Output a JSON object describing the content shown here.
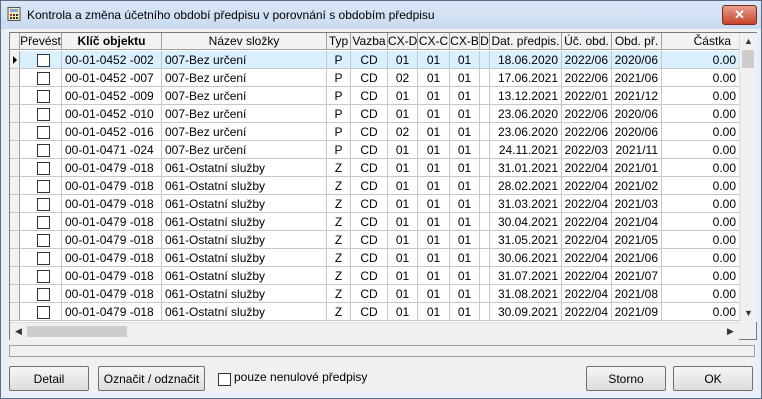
{
  "window": {
    "title": "Kontrola a změna účetního období předpisu v porovnání s obdobím předpisu",
    "close_glyph": "✕"
  },
  "table": {
    "columns": [
      "Převést",
      "Klíč objektu",
      "Název složky",
      "Typ",
      "Vazba",
      "CX-D",
      "CX-C",
      "CX-B",
      "D",
      "Dat. předpis.",
      "Úč. obd.",
      "Obd. př.",
      "Částka"
    ],
    "rows": [
      {
        "klic": "00-01-0452 -002",
        "nazev": "007-Bez určení",
        "typ": "P",
        "vazba": "CD",
        "cxd": "01",
        "cxc": "01",
        "cxb": "01",
        "d": "",
        "dat": "18.06.2020",
        "uc": "2022/06",
        "obd": "2020/06",
        "castka": "0.00"
      },
      {
        "klic": "00-01-0452 -007",
        "nazev": "007-Bez určení",
        "typ": "P",
        "vazba": "CD",
        "cxd": "02",
        "cxc": "01",
        "cxb": "01",
        "d": "",
        "dat": "17.06.2021",
        "uc": "2022/06",
        "obd": "2021/06",
        "castka": "0.00"
      },
      {
        "klic": "00-01-0452 -009",
        "nazev": "007-Bez určení",
        "typ": "P",
        "vazba": "CD",
        "cxd": "01",
        "cxc": "01",
        "cxb": "01",
        "d": "",
        "dat": "13.12.2021",
        "uc": "2022/01",
        "obd": "2021/12",
        "castka": "0.00"
      },
      {
        "klic": "00-01-0452 -010",
        "nazev": "007-Bez určení",
        "typ": "P",
        "vazba": "CD",
        "cxd": "01",
        "cxc": "01",
        "cxb": "01",
        "d": "",
        "dat": "23.06.2020",
        "uc": "2022/06",
        "obd": "2020/06",
        "castka": "0.00"
      },
      {
        "klic": "00-01-0452 -016",
        "nazev": "007-Bez určení",
        "typ": "P",
        "vazba": "CD",
        "cxd": "02",
        "cxc": "01",
        "cxb": "01",
        "d": "",
        "dat": "23.06.2020",
        "uc": "2022/06",
        "obd": "2020/06",
        "castka": "0.00"
      },
      {
        "klic": "00-01-0471 -024",
        "nazev": "007-Bez určení",
        "typ": "P",
        "vazba": "CD",
        "cxd": "01",
        "cxc": "01",
        "cxb": "01",
        "d": "",
        "dat": "24.11.2021",
        "uc": "2022/03",
        "obd": "2021/11",
        "castka": "0.00"
      },
      {
        "klic": "00-01-0479 -018",
        "nazev": "061-Ostatní služby",
        "typ": "Z",
        "vazba": "CD",
        "cxd": "01",
        "cxc": "01",
        "cxb": "01",
        "d": "",
        "dat": "31.01.2021",
        "uc": "2022/04",
        "obd": "2021/01",
        "castka": "0.00"
      },
      {
        "klic": "00-01-0479 -018",
        "nazev": "061-Ostatní služby",
        "typ": "Z",
        "vazba": "CD",
        "cxd": "01",
        "cxc": "01",
        "cxb": "01",
        "d": "",
        "dat": "28.02.2021",
        "uc": "2022/04",
        "obd": "2021/02",
        "castka": "0.00"
      },
      {
        "klic": "00-01-0479 -018",
        "nazev": "061-Ostatní služby",
        "typ": "Z",
        "vazba": "CD",
        "cxd": "01",
        "cxc": "01",
        "cxb": "01",
        "d": "",
        "dat": "31.03.2021",
        "uc": "2022/04",
        "obd": "2021/03",
        "castka": "0.00"
      },
      {
        "klic": "00-01-0479 -018",
        "nazev": "061-Ostatní služby",
        "typ": "Z",
        "vazba": "CD",
        "cxd": "01",
        "cxc": "01",
        "cxb": "01",
        "d": "",
        "dat": "30.04.2021",
        "uc": "2022/04",
        "obd": "2021/04",
        "castka": "0.00"
      },
      {
        "klic": "00-01-0479 -018",
        "nazev": "061-Ostatní služby",
        "typ": "Z",
        "vazba": "CD",
        "cxd": "01",
        "cxc": "01",
        "cxb": "01",
        "d": "",
        "dat": "31.05.2021",
        "uc": "2022/04",
        "obd": "2021/05",
        "castka": "0.00"
      },
      {
        "klic": "00-01-0479 -018",
        "nazev": "061-Ostatní služby",
        "typ": "Z",
        "vazba": "CD",
        "cxd": "01",
        "cxc": "01",
        "cxb": "01",
        "d": "",
        "dat": "30.06.2021",
        "uc": "2022/04",
        "obd": "2021/06",
        "castka": "0.00"
      },
      {
        "klic": "00-01-0479 -018",
        "nazev": "061-Ostatní služby",
        "typ": "Z",
        "vazba": "CD",
        "cxd": "01",
        "cxc": "01",
        "cxb": "01",
        "d": "",
        "dat": "31.07.2021",
        "uc": "2022/04",
        "obd": "2021/07",
        "castka": "0.00"
      },
      {
        "klic": "00-01-0479 -018",
        "nazev": "061-Ostatní služby",
        "typ": "Z",
        "vazba": "CD",
        "cxd": "01",
        "cxc": "01",
        "cxb": "01",
        "d": "",
        "dat": "31.08.2021",
        "uc": "2022/04",
        "obd": "2021/08",
        "castka": "0.00"
      },
      {
        "klic": "00-01-0479 -018",
        "nazev": "061-Ostatní služby",
        "typ": "Z",
        "vazba": "CD",
        "cxd": "01",
        "cxc": "01",
        "cxb": "01",
        "d": "",
        "dat": "30.09.2021",
        "uc": "2022/04",
        "obd": "2021/09",
        "castka": "0.00"
      }
    ]
  },
  "buttons": {
    "detail": "Detail",
    "toggle": "Označit / odznačit",
    "storno": "Storno",
    "ok": "OK"
  },
  "filter": {
    "nonzero_label": "pouze nenulové předpisy"
  },
  "icons": {
    "app": "calculator-icon",
    "close": "close-icon",
    "scroll_up": "▲",
    "scroll_down": "▼",
    "scroll_left": "◀",
    "scroll_right": "▶"
  },
  "colors": {
    "selected_row": "#daf0ff",
    "close_button": "#c7432a"
  }
}
